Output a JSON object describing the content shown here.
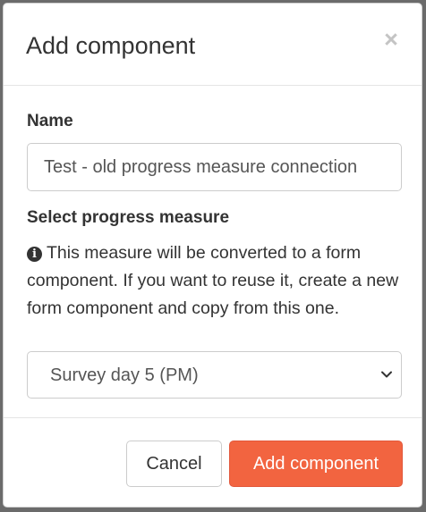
{
  "dialog": {
    "title": "Add component",
    "close_symbol": "×"
  },
  "form": {
    "name_label": "Name",
    "name_value": "Test - old progress measure connection",
    "measure_label": "Select progress measure",
    "info_icon": "info-circle-icon",
    "help_text": "This measure will be converted to a form component. If you want to reuse it, create a new form component and copy from this one.",
    "selected_measure": "Survey day 5 (PM)"
  },
  "footer": {
    "cancel_label": "Cancel",
    "submit_label": "Add component"
  },
  "colors": {
    "primary": "#f26440",
    "text": "#333333",
    "border": "#cccccc"
  }
}
